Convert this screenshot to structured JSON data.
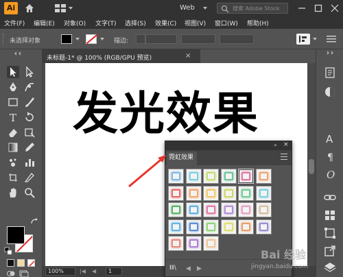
{
  "titlebar": {
    "app_logo": "Ai",
    "workspace": "Web",
    "search_placeholder": "搜索 Adobe Stock"
  },
  "menu": [
    "文件(F)",
    "编辑(E)",
    "对象(O)",
    "文字(T)",
    "选择(S)",
    "效果(C)",
    "视图(V)",
    "窗口(W)",
    "帮助(H)"
  ],
  "control_bar": {
    "selection_status": "未选择对象",
    "stroke_label": "描边:"
  },
  "document": {
    "tab_label": "未标题-1* @ 100% (RGB/GPU 预览)",
    "close": "×",
    "headline_text": "发光效果"
  },
  "status_bar": {
    "zoom": "100%",
    "page": "1"
  },
  "panel": {
    "tab_label": "霓虹效果",
    "collapse": "»",
    "close": "×",
    "swatch_colors": [
      [
        "#7fb8e6",
        "#7fd0e0",
        "#c7dc6f",
        "#6fc59a",
        "#e27aa6",
        "#f0a673"
      ],
      [
        "#e86a6a",
        "#f2a86b",
        "#f2c96b",
        "#cfd66b",
        "#6fcf94",
        "#7fd0e0"
      ],
      [
        "#5ab36b",
        "#67b0e6",
        "#e27aa6",
        "#b68fd6",
        "#e8a0c4",
        "#d6c0a0"
      ],
      [
        "#63b6e8",
        "#5b8fd6",
        "#8fd67a",
        "#e0e070",
        "#e9a06a",
        "#9b8fcf"
      ],
      [
        "#e88a7a",
        "#b07fd6",
        "#f0c49a"
      ]
    ]
  },
  "watermark": {
    "brand": "Bai 经验",
    "url": "jingyan.baidu.com"
  },
  "colors": {
    "app_bg": "#535353",
    "titlebar_bg": "#323232",
    "logo_orange": "#f59a23",
    "arrow_red": "#e8352b"
  }
}
